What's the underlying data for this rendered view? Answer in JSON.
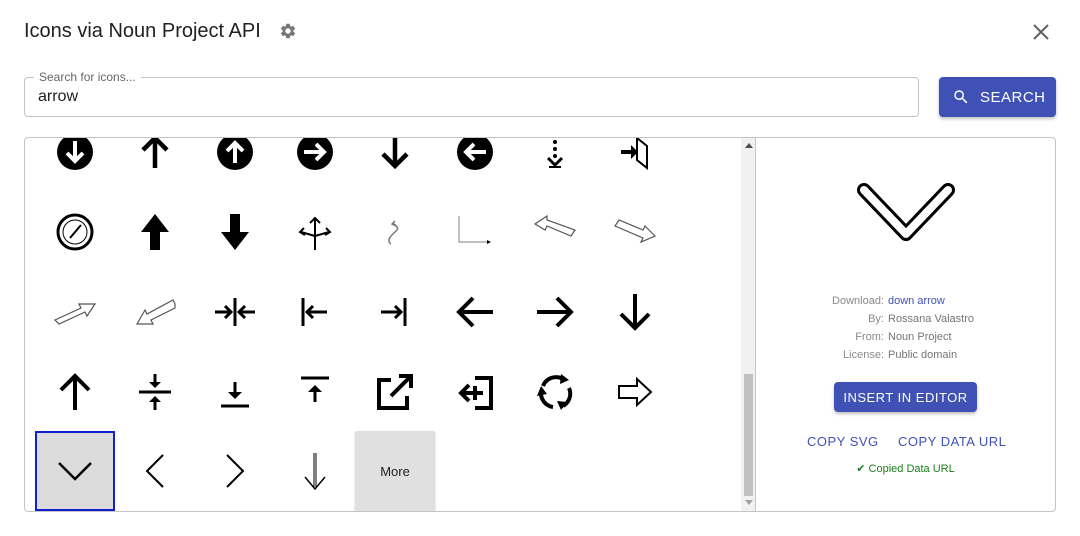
{
  "dialog": {
    "title": "Icons via Noun Project API",
    "settings_icon": "gear-icon",
    "close_icon": "close-icon"
  },
  "search": {
    "label": "Search for icons...",
    "value": "arrow",
    "button_label": "SEARCH",
    "button_icon": "search-icon"
  },
  "results": {
    "more_label": "More",
    "selected_index": 32,
    "icons": [
      "arrow-down-circle-icon",
      "arrow-up-icon",
      "arrow-up-circle-icon",
      "arrow-right-circle-icon",
      "arrow-down-icon",
      "arrow-left-circle-icon",
      "dotted-arrow-down-icon",
      "exit-door-arrow-icon",
      "compass-gauge-icon",
      "arrow-up-bold-icon",
      "arrow-down-bold-icon",
      "split-arrows-icon",
      "curved-arrow-icon",
      "corner-arrow-icon",
      "outline-arrow-up-left-icon",
      "outline-arrow-down-right-icon",
      "outline-arrow-up-right-icon",
      "outline-arrow-down-left-icon",
      "collapse-horizontal-icon",
      "arrow-left-to-bar-icon",
      "arrow-right-to-bar-icon",
      "arrow-left-icon",
      "arrow-right-icon",
      "arrow-down-icon",
      "arrow-up-icon",
      "collapse-vertical-icon",
      "download-tray-icon",
      "upload-bar-icon",
      "external-link-icon",
      "login-arrow-icon",
      "refresh-cycle-icon",
      "outline-arrow-right-icon",
      "chevron-down-icon",
      "chevron-left-icon",
      "chevron-right-icon",
      "thin-arrow-down-icon"
    ]
  },
  "detail": {
    "preview_icon": "chevron-down-icon",
    "download_label": "Download:",
    "download_value": "down arrow",
    "by_label": "By:",
    "by_value": "Rossana Valastro",
    "from_label": "From:",
    "from_value": "Noun Project",
    "license_label": "License:",
    "license_value": "Public domain",
    "insert_label": "INSERT IN EDITOR",
    "copy_svg_label": "COPY SVG",
    "copy_url_label": "COPY DATA URL",
    "status_text": "✔ Copied Data URL"
  },
  "colors": {
    "primary": "#3f51b5",
    "selected_border": "#1020d0",
    "success": "#1a7f1a"
  }
}
